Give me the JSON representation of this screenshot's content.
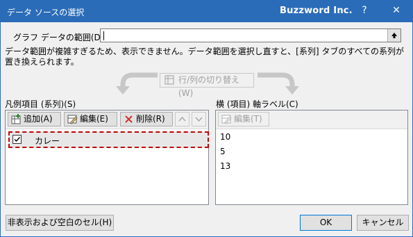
{
  "titlebar": {
    "title": "データ ソースの選択",
    "brand": "Buzzword Inc.",
    "help_label": "?",
    "close_label": "✕"
  },
  "range": {
    "label": "グラフ データの範囲(D):",
    "value": "",
    "collapse_icon": "collapse-dialog-icon"
  },
  "message": "データ範囲が複雑すぎるため、表示できません。データ範囲を選択し直すと、[系列] タブのすべての系列が置き換えられます。",
  "switch_button": {
    "label": "行/列の切り替え(W)",
    "enabled": false
  },
  "series_panel": {
    "label": "凡例項目 (系列)(S)",
    "add_label": "追加(A)",
    "edit_label": "編集(E)",
    "delete_label": "削除(R)",
    "items": [
      {
        "name": "カレー",
        "checked": true
      }
    ]
  },
  "category_panel": {
    "label": "横 (項目) 軸ラベル(C)",
    "edit_label": "編集(T)",
    "items": [
      "10",
      "5",
      "13"
    ]
  },
  "footer": {
    "hidden_cells_label": "非表示および空白のセル(H)",
    "ok_label": "OK",
    "cancel_label": "キャンセル"
  },
  "colors": {
    "titlebar": "#2b6cb8",
    "highlight_border": "#c00000",
    "ok_border": "#0078d7"
  }
}
